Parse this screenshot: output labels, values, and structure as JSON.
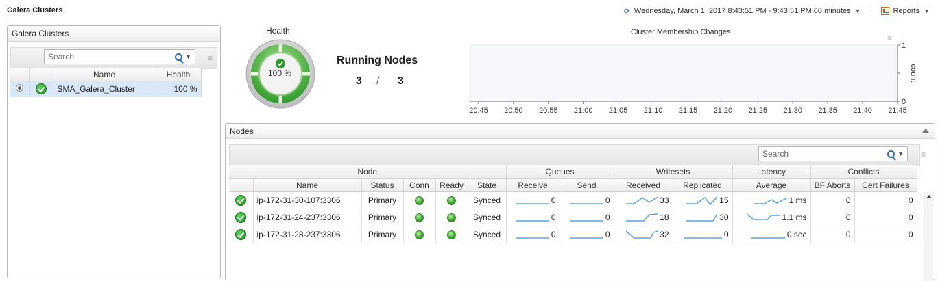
{
  "page": {
    "title": "Galera Clusters",
    "time_range": "Wednesday, March 1, 2017 8:43:51 PM - 9:43:51 PM 60 minutes",
    "reports_label": "Reports"
  },
  "left_panel": {
    "title": "Galera Clusters",
    "search_placeholder": "Search",
    "columns": [
      "Name",
      "Health"
    ],
    "rows": [
      {
        "name": "SMA_Galera_Cluster",
        "health": "100 %"
      }
    ]
  },
  "summary": {
    "health_label": "Health",
    "health_value": "100 %",
    "running_title": "Running Nodes",
    "running_current": "3",
    "running_sep": "/",
    "running_total": "3"
  },
  "chart_data": {
    "type": "line",
    "title": "Cluster Membership Changes",
    "ylabel": "count",
    "xlabel": "",
    "ylim": [
      0,
      1
    ],
    "yticks": [
      "0",
      "1"
    ],
    "x": [
      "20:45",
      "20:50",
      "20:55",
      "21:00",
      "21:05",
      "21:10",
      "21:15",
      "21:20",
      "21:25",
      "21:30",
      "21:35",
      "21:40",
      "21:45"
    ],
    "series": [],
    "grid": false
  },
  "nodes_panel": {
    "title": "Nodes",
    "search_placeholder": "Search",
    "groups": [
      "Node",
      "Queues",
      "Writesets",
      "Latency",
      "Conflicts"
    ],
    "columns": [
      "Name",
      "Status",
      "Conn",
      "Ready",
      "State",
      "Receive",
      "Send",
      "Received",
      "Replicated",
      "Average",
      "BF Aborts",
      "Cert Failures"
    ],
    "rows": [
      {
        "name": "ip-172-31-30-107:3306",
        "status": "Primary",
        "state": "Synced",
        "receive": "0",
        "send": "0",
        "received": "33",
        "replicated": "15",
        "average": "1 ms",
        "bf_aborts": "0",
        "cert_failures": "0"
      },
      {
        "name": "ip-172-31-24-237:3306",
        "status": "Primary",
        "state": "Synced",
        "receive": "0",
        "send": "0",
        "received": "18",
        "replicated": "30",
        "average": "1.1 ms",
        "bf_aborts": "0",
        "cert_failures": "0"
      },
      {
        "name": "ip-172-31-28-237:3306",
        "status": "Primary",
        "state": "Synced",
        "receive": "0",
        "send": "0",
        "received": "32",
        "replicated": "0",
        "average": "0 sec",
        "bf_aborts": "0",
        "cert_failures": "0"
      }
    ]
  },
  "colors": {
    "ok_green": "#2e9b2e",
    "sparkline_blue": "#5aa2e0",
    "selection_blue": "#d9e8f8"
  }
}
